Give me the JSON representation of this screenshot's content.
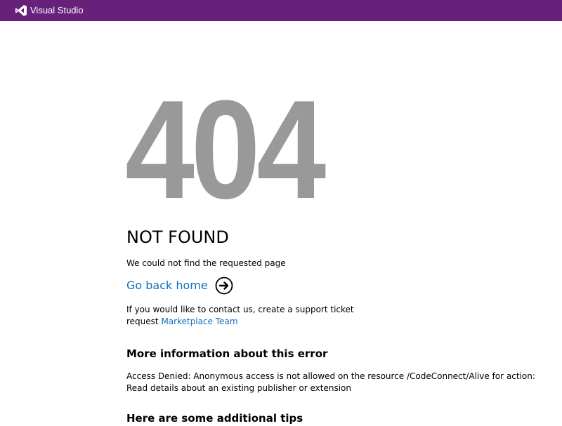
{
  "header": {
    "brand": "Visual Studio",
    "background_color": "#68217a",
    "logo_icon": "visual-studio-logo-icon"
  },
  "error": {
    "code": "404",
    "code_color": "#999999",
    "title": "NOT FOUND",
    "message": "We could not find the requested page"
  },
  "home_link": {
    "label": "Go back home",
    "icon": "arrow-right-circle-icon",
    "color": "#106ebe"
  },
  "contact": {
    "text": "If you would like to contact us, create a support ticket request ",
    "link_label": "Marketplace Team"
  },
  "more_info": {
    "heading": "More information about this error",
    "detail": "Access Denied: Anonymous access is not allowed on the resource /CodeConnect/Alive for action: Read details about an existing publisher or extension"
  },
  "tips": {
    "heading": "Here are some additional tips"
  }
}
